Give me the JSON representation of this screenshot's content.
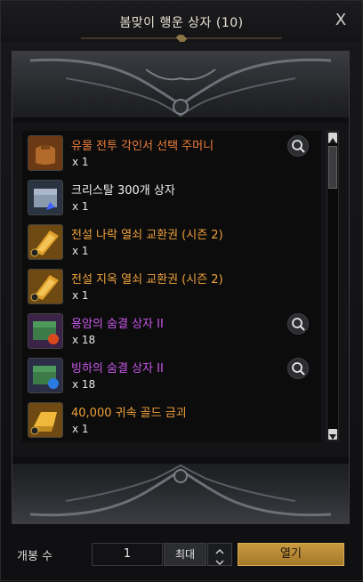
{
  "window": {
    "title": "봄맞이 행운 상자 (10)",
    "close_label": "X"
  },
  "items": [
    {
      "name": "유물 전투 각인서 선택 주머니",
      "qty": "x 1",
      "color": "#f07f3a",
      "icon": "pouch-icon",
      "zoom": true
    },
    {
      "name": "크리스탈 300개 상자",
      "qty": "x 1",
      "color": "#f0f0f0",
      "icon": "crystal-chest-icon",
      "zoom": false
    },
    {
      "name": "전설 나락 열쇠 교환권 (시즌 2)",
      "qty": "x 1",
      "color": "#f0a23a",
      "icon": "gold-ticket-icon",
      "zoom": false
    },
    {
      "name": "전설 지옥 열쇠 교환권 (시즌 2)",
      "qty": "x 1",
      "color": "#f0a23a",
      "icon": "gold-ticket-icon",
      "zoom": false
    },
    {
      "name": "용암의 숨결 상자 II",
      "qty": "x 18",
      "color": "#c857e8",
      "icon": "lava-chest-icon",
      "zoom": true
    },
    {
      "name": "빙하의 숨결 상자 II",
      "qty": "x 18",
      "color": "#c857e8",
      "icon": "ice-chest-icon",
      "zoom": true
    },
    {
      "name": "40,000 귀속 골드 금괴",
      "qty": "x 1",
      "color": "#f0a23a",
      "icon": "gold-bar-icon",
      "zoom": false
    }
  ],
  "bottom": {
    "count_label": "개봉 수",
    "count_value": "1",
    "max_label": "최대",
    "open_label": "열기"
  }
}
